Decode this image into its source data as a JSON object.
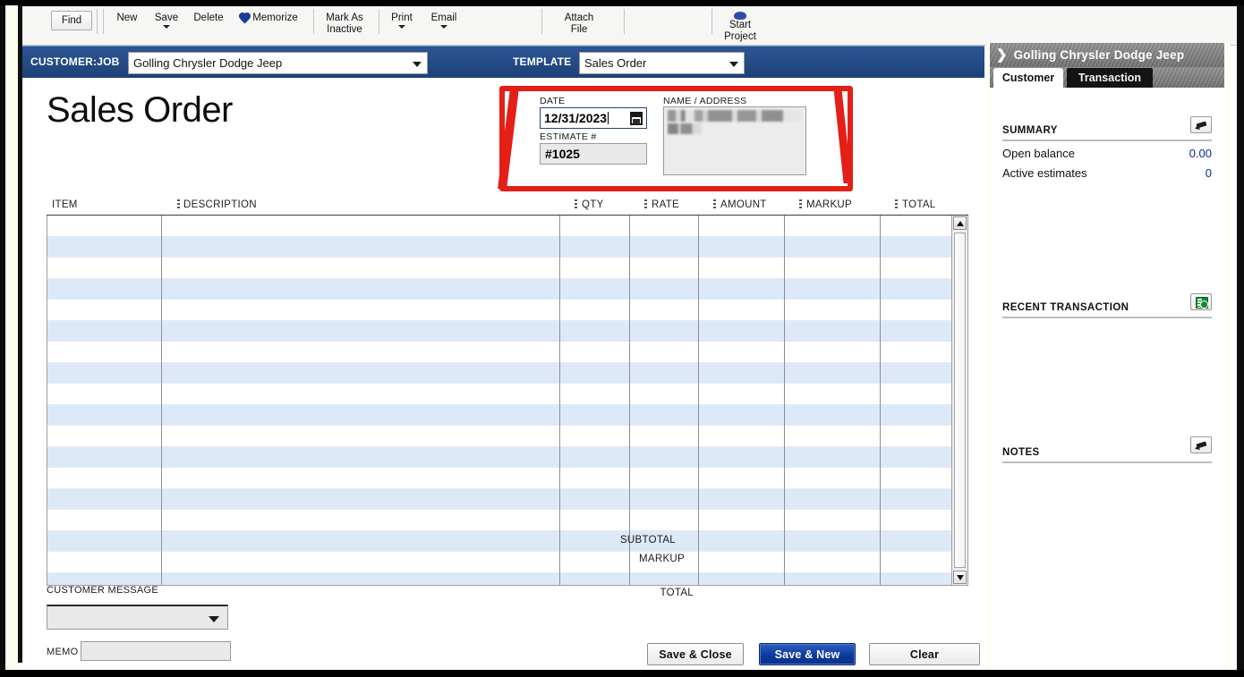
{
  "window": {
    "form_title": "Sales Order"
  },
  "toolbar": {
    "find": "Find",
    "new": "New",
    "save": "Save",
    "delete": "Delete",
    "memorize": "Memorize",
    "mark_as_inactive_line1": "Mark As",
    "mark_as_inactive_line2": "Inactive",
    "print": "Print",
    "email": "Email",
    "attach_line1": "Attach",
    "attach_line2": "File",
    "start_project_line1": "Start",
    "start_project_line2": "Project"
  },
  "header_bar": {
    "customer_job_label": "CUSTOMER:JOB",
    "customer_job_value": "Golling Chrysler Dodge Jeep",
    "template_label": "TEMPLATE",
    "template_value": "Sales Order"
  },
  "form": {
    "date_label": "DATE",
    "date_value": "12/31/2023",
    "estimate_label": "ESTIMATE #",
    "estimate_value": "#1025",
    "name_address_label": "NAME / ADDRESS",
    "name_address_value": ""
  },
  "grid": {
    "columns": [
      "ITEM",
      "DESCRIPTION",
      "QTY",
      "RATE",
      "AMOUNT",
      "MARKUP",
      "TOTAL"
    ],
    "rows": []
  },
  "totals": {
    "subtotal_label": "SUBTOTAL",
    "subtotal_value": "",
    "markup_label": "MARKUP",
    "markup_value": "",
    "total_label": "TOTAL",
    "total_value": ""
  },
  "footer": {
    "customer_message_label": "CUSTOMER MESSAGE",
    "customer_message_value": "",
    "memo_label": "MEMO",
    "memo_value": "",
    "save_close": "Save & Close",
    "save_new": "Save & New",
    "clear": "Clear"
  },
  "side_panel": {
    "title": "Golling Chrysler Dodge Jeep",
    "tabs": [
      {
        "label": "Customer",
        "active": true
      },
      {
        "label": "Transaction",
        "active": false
      }
    ],
    "summary_heading": "SUMMARY",
    "summary_rows": [
      {
        "label": "Open balance",
        "value": "0.00"
      },
      {
        "label": "Active estimates",
        "value": "0"
      }
    ],
    "recent_transaction_heading": "RECENT TRANSACTION",
    "notes_heading": "NOTES"
  },
  "colors": {
    "header_blue": "#2c5694",
    "primary_button": "#0e3a9c",
    "highlight_red": "#e41f18",
    "row_alt_blue": "#dde9f8",
    "panel_value_blue": "#0d2a8c"
  }
}
